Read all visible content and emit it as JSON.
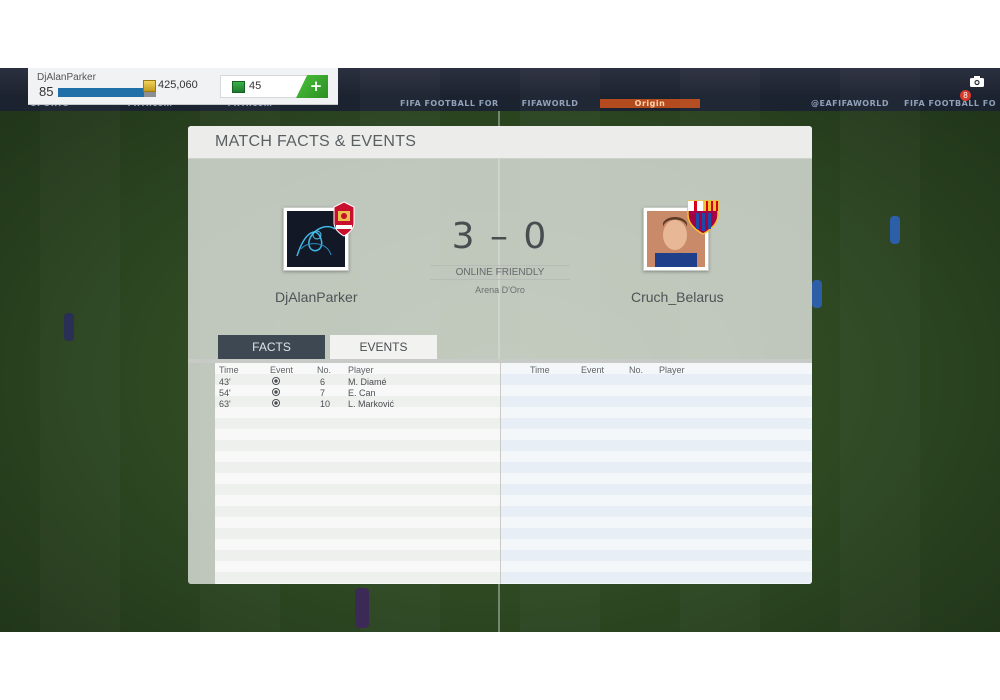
{
  "hud": {
    "username": "DjAlanParker",
    "level": "85",
    "xp_progress": 0.88,
    "coins": "425,060",
    "points": "45",
    "buy_points_label": "+",
    "notification_count": "8"
  },
  "board_ads": [
    "SPORTS",
    "FIFA.com",
    "FIFA.com",
    "",
    "FIFA  FOOTBALL FOR HOPE",
    "FIFAWORLD",
    "Origin",
    "",
    "@EAFIFAWORLD",
    "FIFA  FOOTBALL FO"
  ],
  "panel": {
    "title": "MATCH FACTS & EVENTS",
    "home_team": "DjAlanParker",
    "away_team": "Cruch_Belarus",
    "score": "3 – 0",
    "match_type": "ONLINE FRIENDLY",
    "venue": "Arena D'Oro",
    "tabs": {
      "facts": "FACTS",
      "events": "EVENTS"
    },
    "columns": {
      "time": "Time",
      "event": "Event",
      "number": "No.",
      "player": "Player"
    },
    "home_events": [
      {
        "time": "43'",
        "event_icon": "ball-icon",
        "number": "6",
        "player": "M. Diamé"
      },
      {
        "time": "54'",
        "event_icon": "ball-icon",
        "number": "7",
        "player": "E. Can"
      },
      {
        "time": "63'",
        "event_icon": "ball-icon",
        "number": "10",
        "player": "L. Marković"
      }
    ],
    "away_events": []
  },
  "colors": {
    "active_tab": "#3d4852",
    "plus_button": "#3aa62e",
    "xp_bar": "#1f6fa8",
    "notification": "#d63a28"
  }
}
